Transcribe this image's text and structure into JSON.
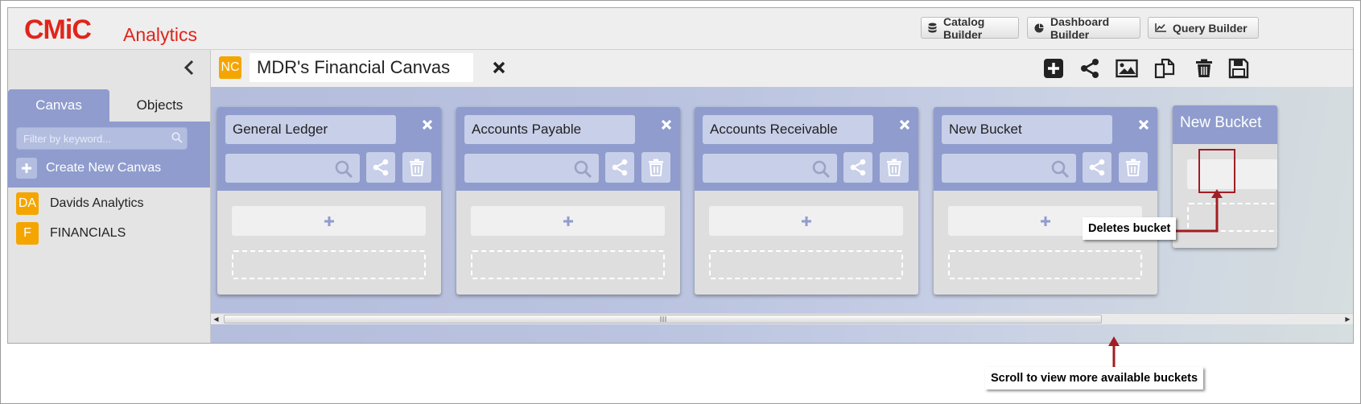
{
  "header": {
    "logo": "CMiC",
    "app_name": "Analytics",
    "buttons": [
      {
        "label": "Catalog Builder",
        "icon": "database-icon"
      },
      {
        "label": "Dashboard Builder",
        "icon": "pie-chart-icon"
      },
      {
        "label": "Query Builder",
        "icon": "line-chart-icon"
      }
    ]
  },
  "sidebar": {
    "tabs": [
      "Canvas",
      "Objects"
    ],
    "active_tab": "Canvas",
    "filter_placeholder": "Filter by keyword...",
    "create_label": "Create New Canvas",
    "canvases": [
      {
        "badge": "DA",
        "name": "Davids Analytics"
      },
      {
        "badge": "F",
        "name": "FINANCIALS"
      }
    ]
  },
  "canvas": {
    "badge": "NC",
    "title": "MDR's Financial Canvas",
    "toolbar": [
      "add-icon",
      "share-icon",
      "image-icon",
      "copy-icon",
      "trash-icon",
      "save-icon"
    ]
  },
  "buckets": [
    {
      "name": "General Ledger"
    },
    {
      "name": "Accounts Payable"
    },
    {
      "name": "Accounts Receivable"
    },
    {
      "name": "New Bucket"
    }
  ],
  "partial_bucket": {
    "name": "New Bucket"
  },
  "annotations": {
    "delete": "Deletes bucket",
    "scroll": "Scroll to view more available buckets"
  },
  "colors": {
    "brand_red": "#e0251b",
    "bucket_header": "#8f9ccd",
    "badge_orange": "#f5a500",
    "annotation_red": "#a11e22"
  }
}
